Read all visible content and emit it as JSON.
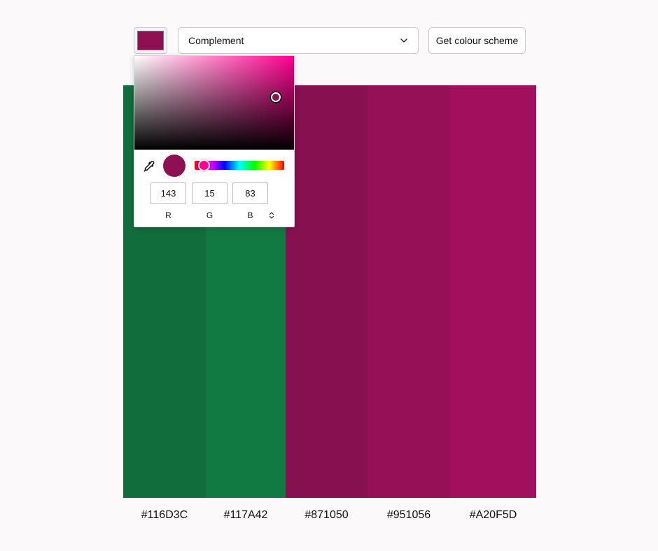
{
  "toolbar": {
    "current_color": "#8F0F53",
    "mode_select": {
      "selected": "Complement",
      "chevron_icon": "chevron-down-icon"
    },
    "get_scheme_label": "Get colour scheme"
  },
  "palette": {
    "swatches": [
      {
        "hex": "#116D3C",
        "label": "#116D3C"
      },
      {
        "hex": "#117A42",
        "label": "#117A42"
      },
      {
        "hex": "#871050",
        "label": "#871050"
      },
      {
        "hex": "#951056",
        "label": "#951056"
      },
      {
        "hex": "#A20F5D",
        "label": "#A20F5D"
      }
    ]
  },
  "picker": {
    "hue_color": "#ff0090",
    "saturation_value": {
      "saturation": 0.885,
      "value": 0.56
    },
    "hue_level": 0.09,
    "preview_color": "#8F0F53",
    "eyedropper_icon": "eyedropper-icon",
    "format_toggle_icon": "up-down-arrows-icon",
    "channels": [
      {
        "label": "R",
        "value": "143"
      },
      {
        "label": "G",
        "value": "15"
      },
      {
        "label": "B",
        "value": "83"
      }
    ]
  }
}
